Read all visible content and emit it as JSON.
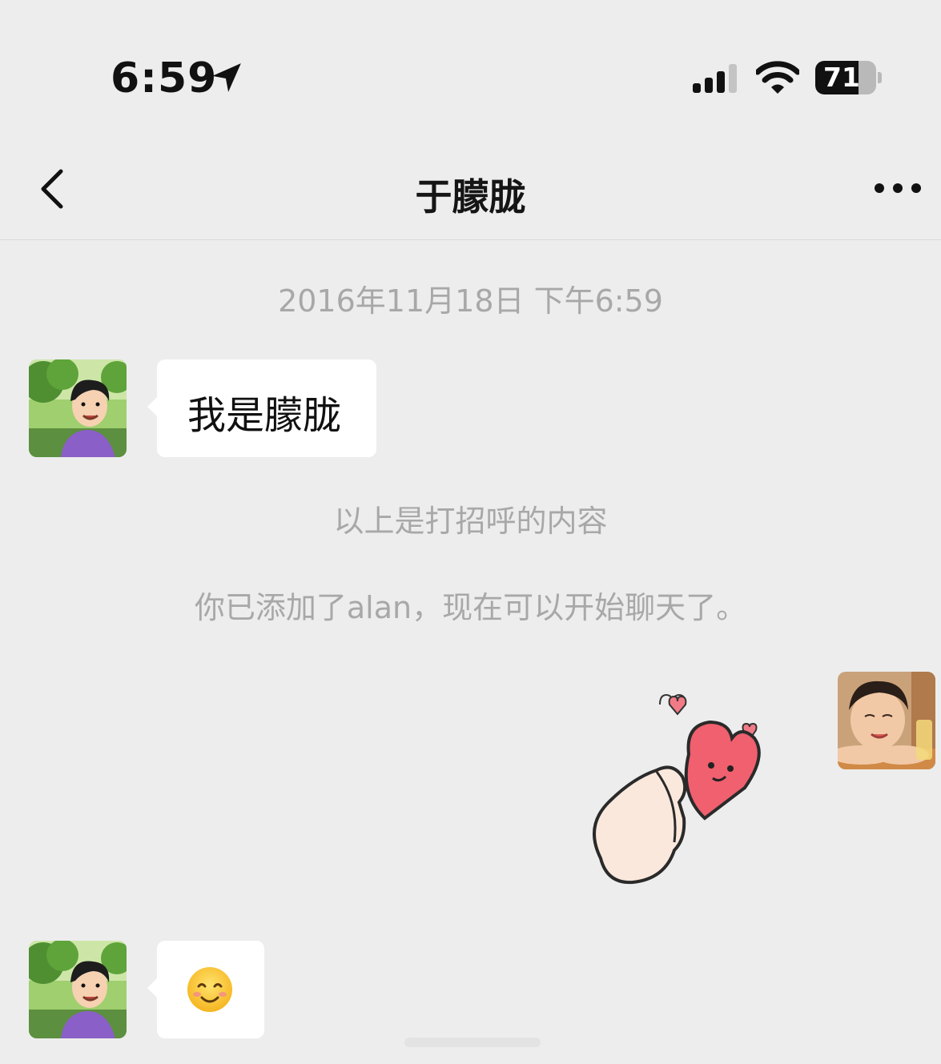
{
  "status_bar": {
    "time": "6:59",
    "battery_level": "71",
    "battery_fraction": 0.71,
    "icons": [
      "location-arrow-icon",
      "cellular-signal-icon",
      "wifi-icon",
      "battery-icon"
    ]
  },
  "nav": {
    "title": "于朦胧",
    "back_icon": "chevron-left-icon",
    "more_icon": "ellipsis-icon"
  },
  "chat": {
    "timestamp": "2016年11月18日 下午6:59",
    "greeting_message": "我是朦胧",
    "system_notes": [
      "以上是打招呼的内容",
      "你已添加了alan，现在可以开始聊天了。"
    ],
    "sticker": "heart-finger-sticker",
    "emoji_message": "smiling-face-emoji"
  },
  "colors": {
    "background": "#ededed",
    "bubble_incoming": "#ffffff",
    "system_text": "#a8a8a8"
  }
}
